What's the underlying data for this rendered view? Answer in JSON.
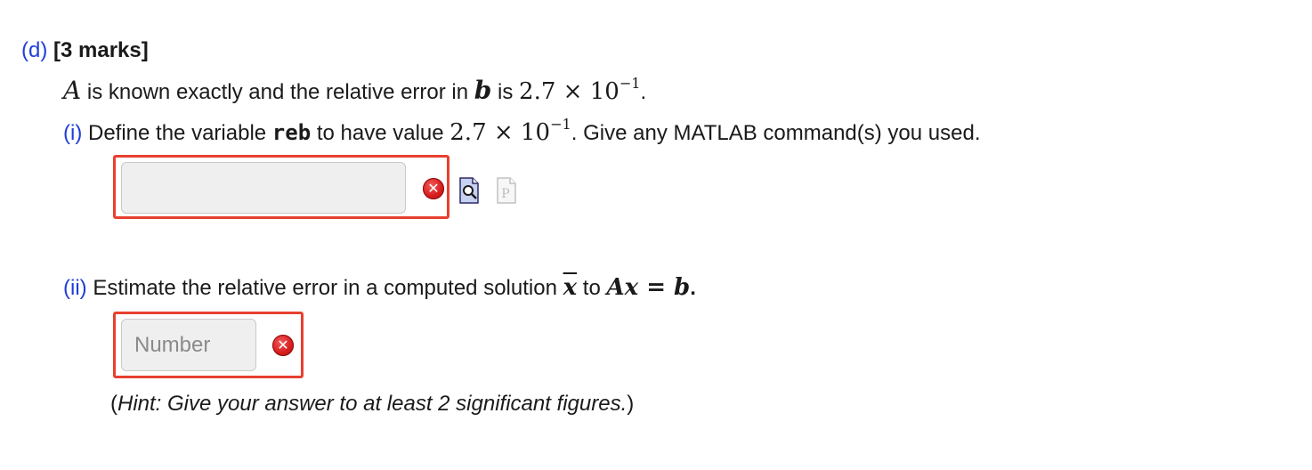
{
  "part_d": {
    "label": "(d)",
    "marks": "[3 marks]"
  },
  "statement": {
    "var_A": "A",
    "text1": " is known exactly and the relative error in ",
    "var_b": "b",
    "text2": " is ",
    "value_mantissa": "2.7 × 10",
    "value_exponent": "−1",
    "end": "."
  },
  "sub_i": {
    "label": "(i)",
    "text1": " Define the variable ",
    "var_name": "reb",
    "text2": " to have value ",
    "value_mantissa": "2.7 × 10",
    "value_exponent": "−1",
    "text3": ". Give any MATLAB command(s) you used.",
    "input_value": "",
    "status_icon": "error-icon",
    "preview_icon": "preview-icon",
    "p_icon": "p-icon",
    "accent_border": "#e8402f"
  },
  "sub_ii": {
    "label": "(ii)",
    "text1": " Estimate the relative error in a computed solution ",
    "var_xbar": "x",
    "text2": " to ",
    "equation": "Ax = b",
    "end": ".",
    "input_placeholder": "Number",
    "input_value": "",
    "status_icon": "error-icon",
    "hint_open": "(",
    "hint_text": "Hint: Give your answer to at least 2 significant figures.",
    "hint_close": ")"
  },
  "colors": {
    "label_blue": "#1f3fd6",
    "error_red": "#d81e1e"
  }
}
